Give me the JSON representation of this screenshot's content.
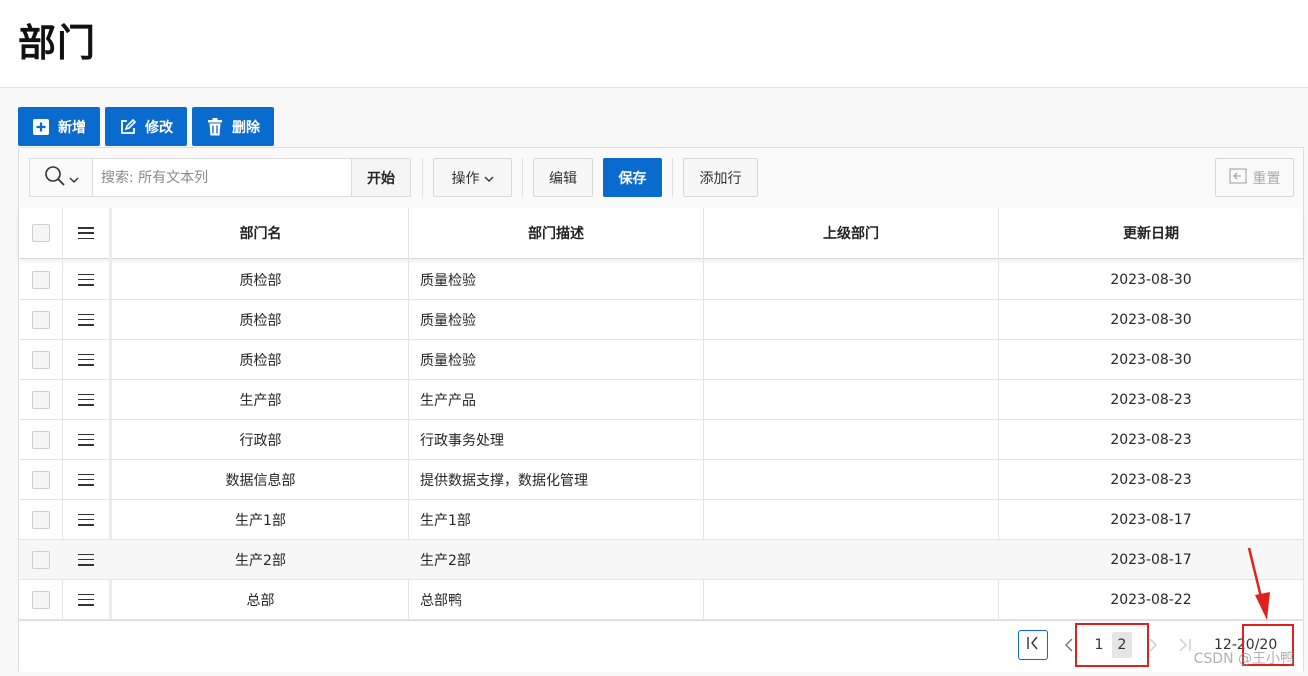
{
  "page": {
    "title": "部门"
  },
  "toolbar": {
    "add_label": "新增",
    "edit_label": "修改",
    "delete_label": "删除"
  },
  "search": {
    "placeholder": "搜索: 所有文本列",
    "value": "",
    "go_label": "开始"
  },
  "actions": {
    "actions_label": "操作",
    "edit_label": "编辑",
    "save_label": "保存",
    "add_row_label": "添加行",
    "reset_label": "重置"
  },
  "grid": {
    "columns": [
      "部门名",
      "部门描述",
      "上级部门",
      "更新日期"
    ],
    "rows": [
      {
        "name": "质检部",
        "desc": "质量检验",
        "parent": "",
        "date": "2023-08-30"
      },
      {
        "name": "质检部",
        "desc": "质量检验",
        "parent": "",
        "date": "2023-08-30"
      },
      {
        "name": "质检部",
        "desc": "质量检验",
        "parent": "",
        "date": "2023-08-30"
      },
      {
        "name": "生产部",
        "desc": "生产产品",
        "parent": "",
        "date": "2023-08-23"
      },
      {
        "name": "行政部",
        "desc": "行政事务处理",
        "parent": "",
        "date": "2023-08-23"
      },
      {
        "name": "数据信息部",
        "desc": "提供数据支撑，数据化管理",
        "parent": "",
        "date": "2023-08-23"
      },
      {
        "name": "生产1部",
        "desc": "生产1部",
        "parent": "",
        "date": "2023-08-17"
      },
      {
        "name": "生产2部",
        "desc": "生产2部",
        "parent": "",
        "date": "2023-08-17"
      },
      {
        "name": "总部",
        "desc": "总部鸭",
        "parent": "",
        "date": "2023-08-22"
      }
    ]
  },
  "pagination": {
    "pages": [
      "1",
      "2"
    ],
    "current_page": "2",
    "range_start": "12",
    "range_sep": " - ",
    "total": "20/20"
  },
  "watermark": "CSDN @王小鸭",
  "colors": {
    "primary": "#0a6bcf",
    "highlight_box": "#e0201b"
  }
}
